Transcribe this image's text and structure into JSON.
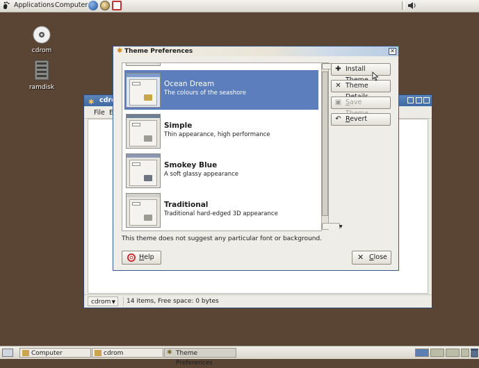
{
  "top_panel": {
    "applications_label": "Applications",
    "computer_label": "Computer"
  },
  "desktop": {
    "icons": [
      {
        "label": "cdrom"
      },
      {
        "label": "ramdisk"
      }
    ]
  },
  "cdrom_window": {
    "title": "cdrom",
    "menu_file": "File",
    "menu_edit": "E",
    "location_combo": "cdrom",
    "status_text": "14 items, Free space: 0 bytes"
  },
  "dialog": {
    "title": "Theme Preferences",
    "themes": [
      {
        "name": "Ocean Dream",
        "description": "The colours of the seashore",
        "selected": true
      },
      {
        "name": "Simple",
        "description": "Thin appearance, high performance",
        "selected": false
      },
      {
        "name": "Smokey Blue",
        "description": "A soft glassy appearance",
        "selected": false
      },
      {
        "name": "Traditional",
        "description": "Traditional hard-edged 3D appearance",
        "selected": false
      }
    ],
    "buttons": {
      "install_theme": "Install Theme...",
      "theme_details_pre": "Theme ",
      "theme_details_mn": "D",
      "theme_details_post": "etails",
      "save_theme_mn": "S",
      "save_theme_post": "ave Theme...",
      "revert_mn": "R",
      "revert_post": "evert",
      "help_mn": "H",
      "help_post": "elp",
      "close_mn": "C",
      "close_post": "lose"
    },
    "info_text": "This theme does not suggest any particular font or background."
  },
  "taskbar": {
    "tasks": [
      {
        "label": "Computer"
      },
      {
        "label": "cdrom"
      },
      {
        "label": "Theme Preferences"
      }
    ]
  },
  "colors": {
    "desktop": "#5a4434",
    "selection": "#5c7ebc",
    "titlebar": "#3e6aa3"
  }
}
